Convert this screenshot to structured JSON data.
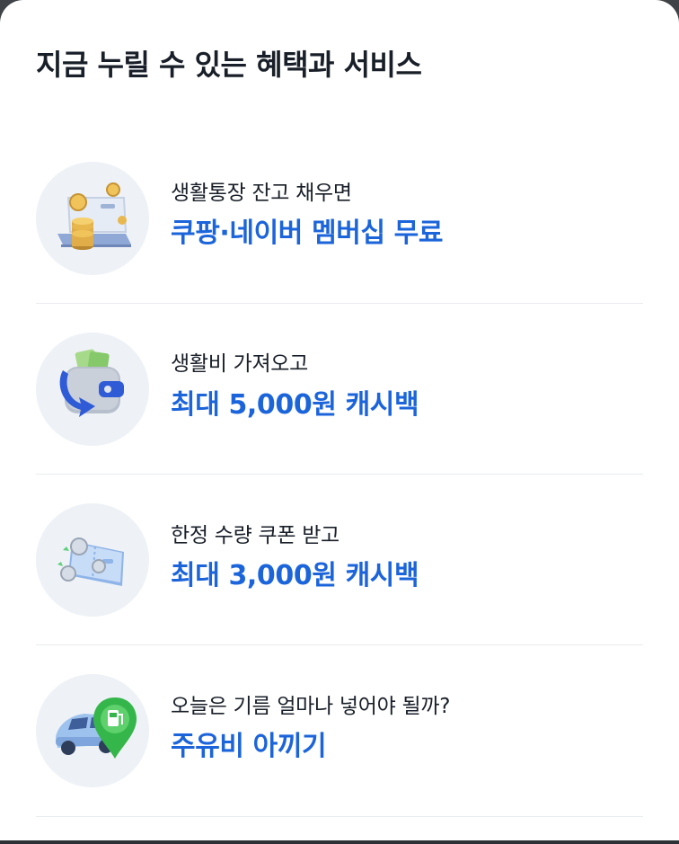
{
  "header": {
    "title": "지금 누릴 수 있는 혜택과 서비스"
  },
  "items": [
    {
      "subtitle": "생활통장 잔고 채우면",
      "headline": "쿠팡·네이버 멤버십 무료",
      "icon": "coins-on-laptop-icon"
    },
    {
      "subtitle": "생활비 가져오고",
      "headline": "최대 5,000원 캐시백",
      "icon": "wallet-cash-arrow-icon"
    },
    {
      "subtitle": "한정 수량 쿠폰 받고",
      "headline": "최대 3,000원 캐시백",
      "icon": "coupon-coins-icon"
    },
    {
      "subtitle": "오늘은 기름 얼마나 넣어야 될까?",
      "headline": "주유비 아끼기",
      "icon": "car-gas-pin-icon"
    }
  ],
  "colors": {
    "accent": "#1b64da",
    "text": "#191f28",
    "thumb_bg": "#eef2f7",
    "divider": "#e8ebee"
  }
}
